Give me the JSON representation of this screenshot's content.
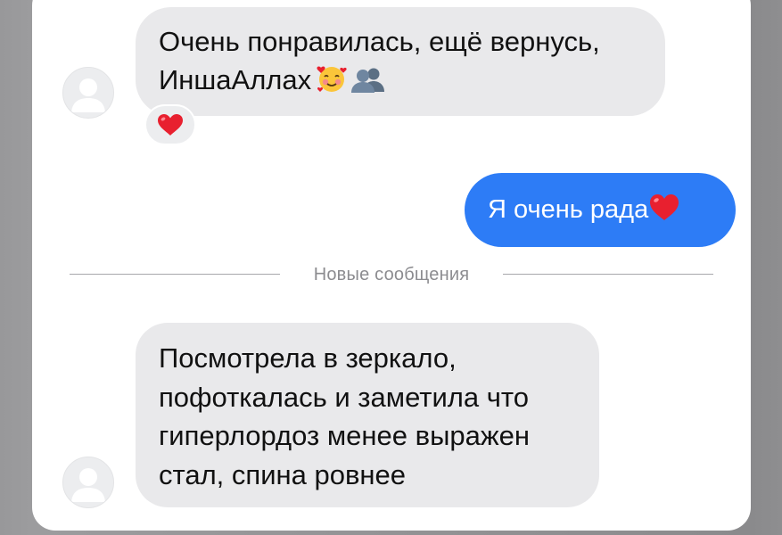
{
  "conversation": {
    "messages": [
      {
        "direction": "incoming",
        "lines": [
          "Очень понравилась, ещё вернусь,",
          "ИншаАллах"
        ],
        "trailing_emoji": [
          "smiling-face-with-hearts-emoji",
          "busts-in-silhouette-emoji"
        ],
        "reaction": "red-heart-emoji"
      },
      {
        "direction": "outgoing",
        "text": "Я очень рада",
        "trailing_emoji": [
          "red-heart-emoji"
        ]
      },
      {
        "direction": "incoming",
        "lines": [
          "Посмотрела в зеркало,",
          "пофоткалась и заметила что",
          "гиперлордоз менее выражен",
          "стал, спина ровнее"
        ]
      }
    ],
    "divider_label": "Новые сообщения"
  },
  "colors": {
    "incoming_bubble": "#e9e9eb",
    "outgoing_bubble": "#2d7cf6",
    "heart": "#e8202f"
  }
}
